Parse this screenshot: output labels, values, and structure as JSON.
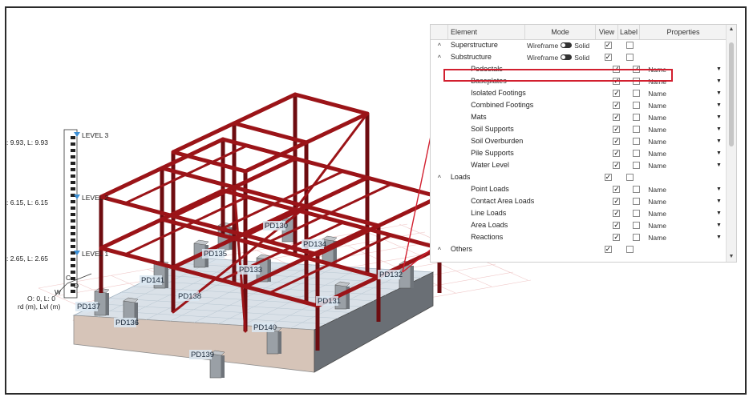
{
  "viewport": {
    "pedestal_labels": [
      "PD130",
      "PD134",
      "PD135",
      "PD133",
      "PD141",
      "PD138",
      "PD132",
      "PD137",
      "PD131",
      "PD136",
      "PD140",
      "PD139"
    ],
    "level_labels": [
      "LEVEL 3",
      "LEVEL 2",
      "LEVEL 1"
    ],
    "elevation_labels": [
      ": 9.93, L: 9.93",
      ": 6.15, L: 6.15",
      ": 2.65, L: 2.65"
    ],
    "origin_label": "O: 0, L: 0",
    "axis_caption": "rd (m), Lvl (m)",
    "axis_letters": [
      "C",
      "D",
      "W"
    ]
  },
  "panel": {
    "columns": [
      "Element",
      "Mode",
      "View",
      "Label",
      "Properties"
    ],
    "mode_left": "Wireframe",
    "mode_right": "Solid",
    "rows": [
      {
        "label": "Superstructure",
        "group": true,
        "mode": true,
        "view": true,
        "label_cb": false,
        "prop": ""
      },
      {
        "label": "Substructure",
        "group": true,
        "mode": true,
        "view": true,
        "label_cb": false,
        "prop": ""
      },
      {
        "label": "Pedestals",
        "group": false,
        "mode": false,
        "view": true,
        "label_cb": true,
        "prop": "Name"
      },
      {
        "label": "Baseplates",
        "group": false,
        "mode": false,
        "view": true,
        "label_cb": false,
        "prop": "Name"
      },
      {
        "label": "Isolated Footings",
        "group": false,
        "mode": false,
        "view": true,
        "label_cb": false,
        "prop": "Name"
      },
      {
        "label": "Combined Footings",
        "group": false,
        "mode": false,
        "view": true,
        "label_cb": false,
        "prop": "Name"
      },
      {
        "label": "Mats",
        "group": false,
        "mode": false,
        "view": true,
        "label_cb": false,
        "prop": "Name"
      },
      {
        "label": "Soil Supports",
        "group": false,
        "mode": false,
        "view": true,
        "label_cb": false,
        "prop": "Name"
      },
      {
        "label": "Soil Overburden",
        "group": false,
        "mode": false,
        "view": true,
        "label_cb": false,
        "prop": "Name"
      },
      {
        "label": "Pile Supports",
        "group": false,
        "mode": false,
        "view": true,
        "label_cb": false,
        "prop": "Name"
      },
      {
        "label": "Water Level",
        "group": false,
        "mode": false,
        "view": true,
        "label_cb": false,
        "prop": "Name"
      },
      {
        "label": "Loads",
        "group": true,
        "mode": false,
        "view": true,
        "label_cb": false,
        "prop": ""
      },
      {
        "label": "Point Loads",
        "group": false,
        "mode": false,
        "view": true,
        "label_cb": false,
        "prop": "Name"
      },
      {
        "label": "Contact Area Loads",
        "group": false,
        "mode": false,
        "view": true,
        "label_cb": false,
        "prop": "Name"
      },
      {
        "label": "Line Loads",
        "group": false,
        "mode": false,
        "view": true,
        "label_cb": false,
        "prop": "Name"
      },
      {
        "label": "Area Loads",
        "group": false,
        "mode": false,
        "view": true,
        "label_cb": false,
        "prop": "Name"
      },
      {
        "label": "Reactions",
        "group": false,
        "mode": false,
        "view": true,
        "label_cb": false,
        "prop": "Name"
      },
      {
        "label": "Others",
        "group": true,
        "mode": false,
        "view": true,
        "label_cb": false,
        "prop": ""
      }
    ]
  },
  "colors": {
    "steel": "#9b1418",
    "steel_dark": "#6e0c10",
    "highlight": "#d21f2f",
    "pedestal": "#8f9297",
    "mat": "#c9d6df",
    "soil": "#f2c4ad"
  },
  "icons": {
    "expand_icon": "^",
    "checkmark": "✓",
    "dropdown_caret": "▼"
  }
}
